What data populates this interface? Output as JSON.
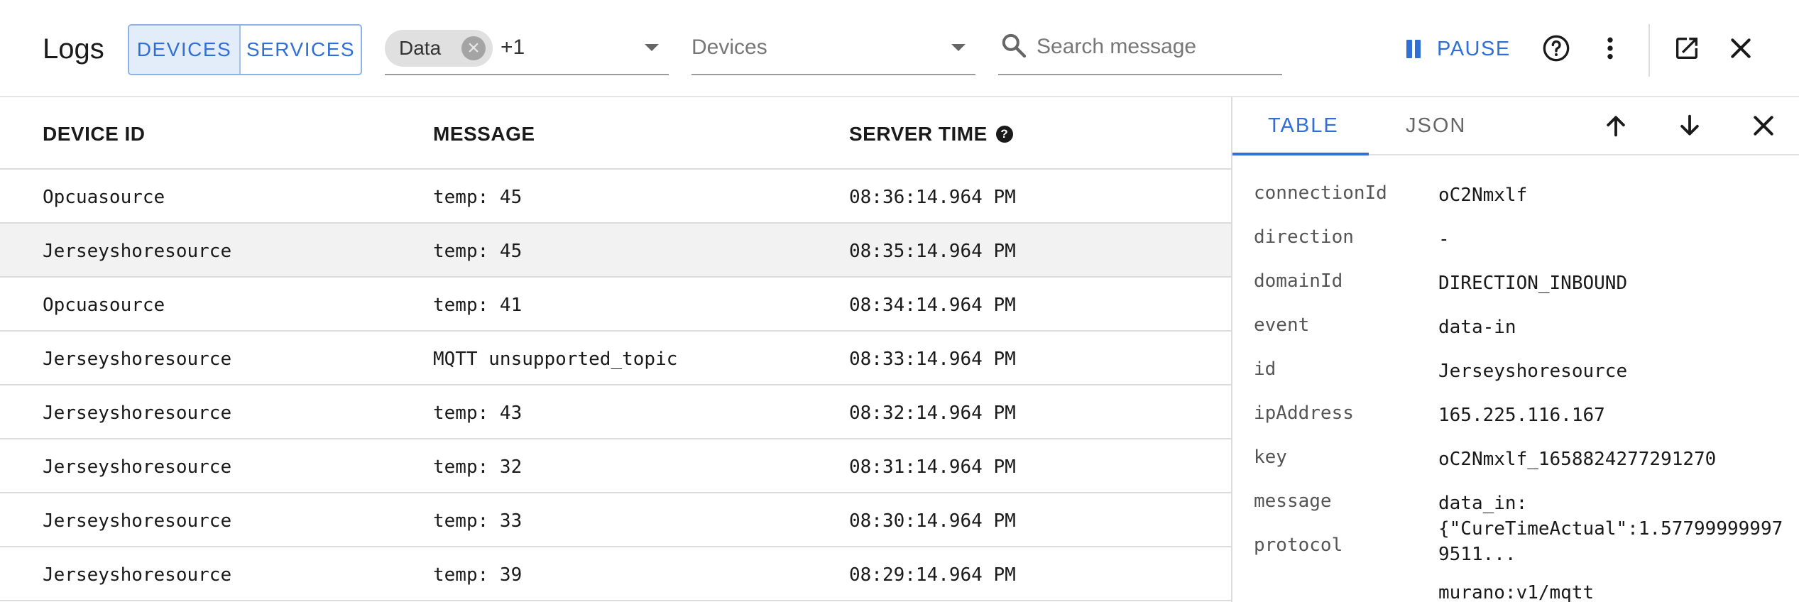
{
  "header": {
    "title": "Logs",
    "segments": [
      "DEVICES",
      "SERVICES"
    ],
    "type_filter": {
      "chip": "Data",
      "more": "+1"
    },
    "device_filter_placeholder": "Devices",
    "search_placeholder": "Search message",
    "pause_label": "PAUSE"
  },
  "table": {
    "columns": [
      "DEVICE ID",
      "MESSAGE",
      "SERVER TIME"
    ],
    "rows": [
      [
        "Opcuasource",
        "temp: 45",
        "08:36:14.964 PM"
      ],
      [
        "Jerseyshoresource",
        "temp: 45",
        "08:35:14.964 PM"
      ],
      [
        "Opcuasource",
        "temp: 41",
        "08:34:14.964 PM"
      ],
      [
        "Jerseyshoresource",
        "MQTT unsupported_topic",
        "08:33:14.964 PM"
      ],
      [
        "Jerseyshoresource",
        "temp: 43",
        "08:32:14.964 PM"
      ],
      [
        "Jerseyshoresource",
        "temp: 32",
        "08:31:14.964 PM"
      ],
      [
        "Jerseyshoresource",
        "temp: 33",
        "08:30:14.964 PM"
      ],
      [
        "Jerseyshoresource",
        "temp: 39",
        "08:29:14.964 PM"
      ]
    ]
  },
  "panel": {
    "tabs": [
      "TABLE",
      "JSON"
    ],
    "fields": [
      {
        "key": "connectionId",
        "value": "oC2Nmxlf"
      },
      {
        "key": "direction",
        "value": "-"
      },
      {
        "key": "domainId",
        "value": "DIRECTION_INBOUND"
      },
      {
        "key": "event",
        "value": "data-in"
      },
      {
        "key": "id",
        "value": "Jerseyshoresource"
      },
      {
        "key": "ipAddress",
        "value": "165.225.116.167"
      },
      {
        "key": "key",
        "value": "oC2Nmxlf_1658824277291270"
      },
      {
        "key": "message",
        "value": "data_in:\n{\"CureTimeActual\":1.577999999979511..."
      },
      {
        "key": "protocol",
        "value": "murano:v1/mqtt"
      }
    ]
  },
  "colors": {
    "accent": "#2f6fd6",
    "selected_row": "#f2f2f2"
  }
}
